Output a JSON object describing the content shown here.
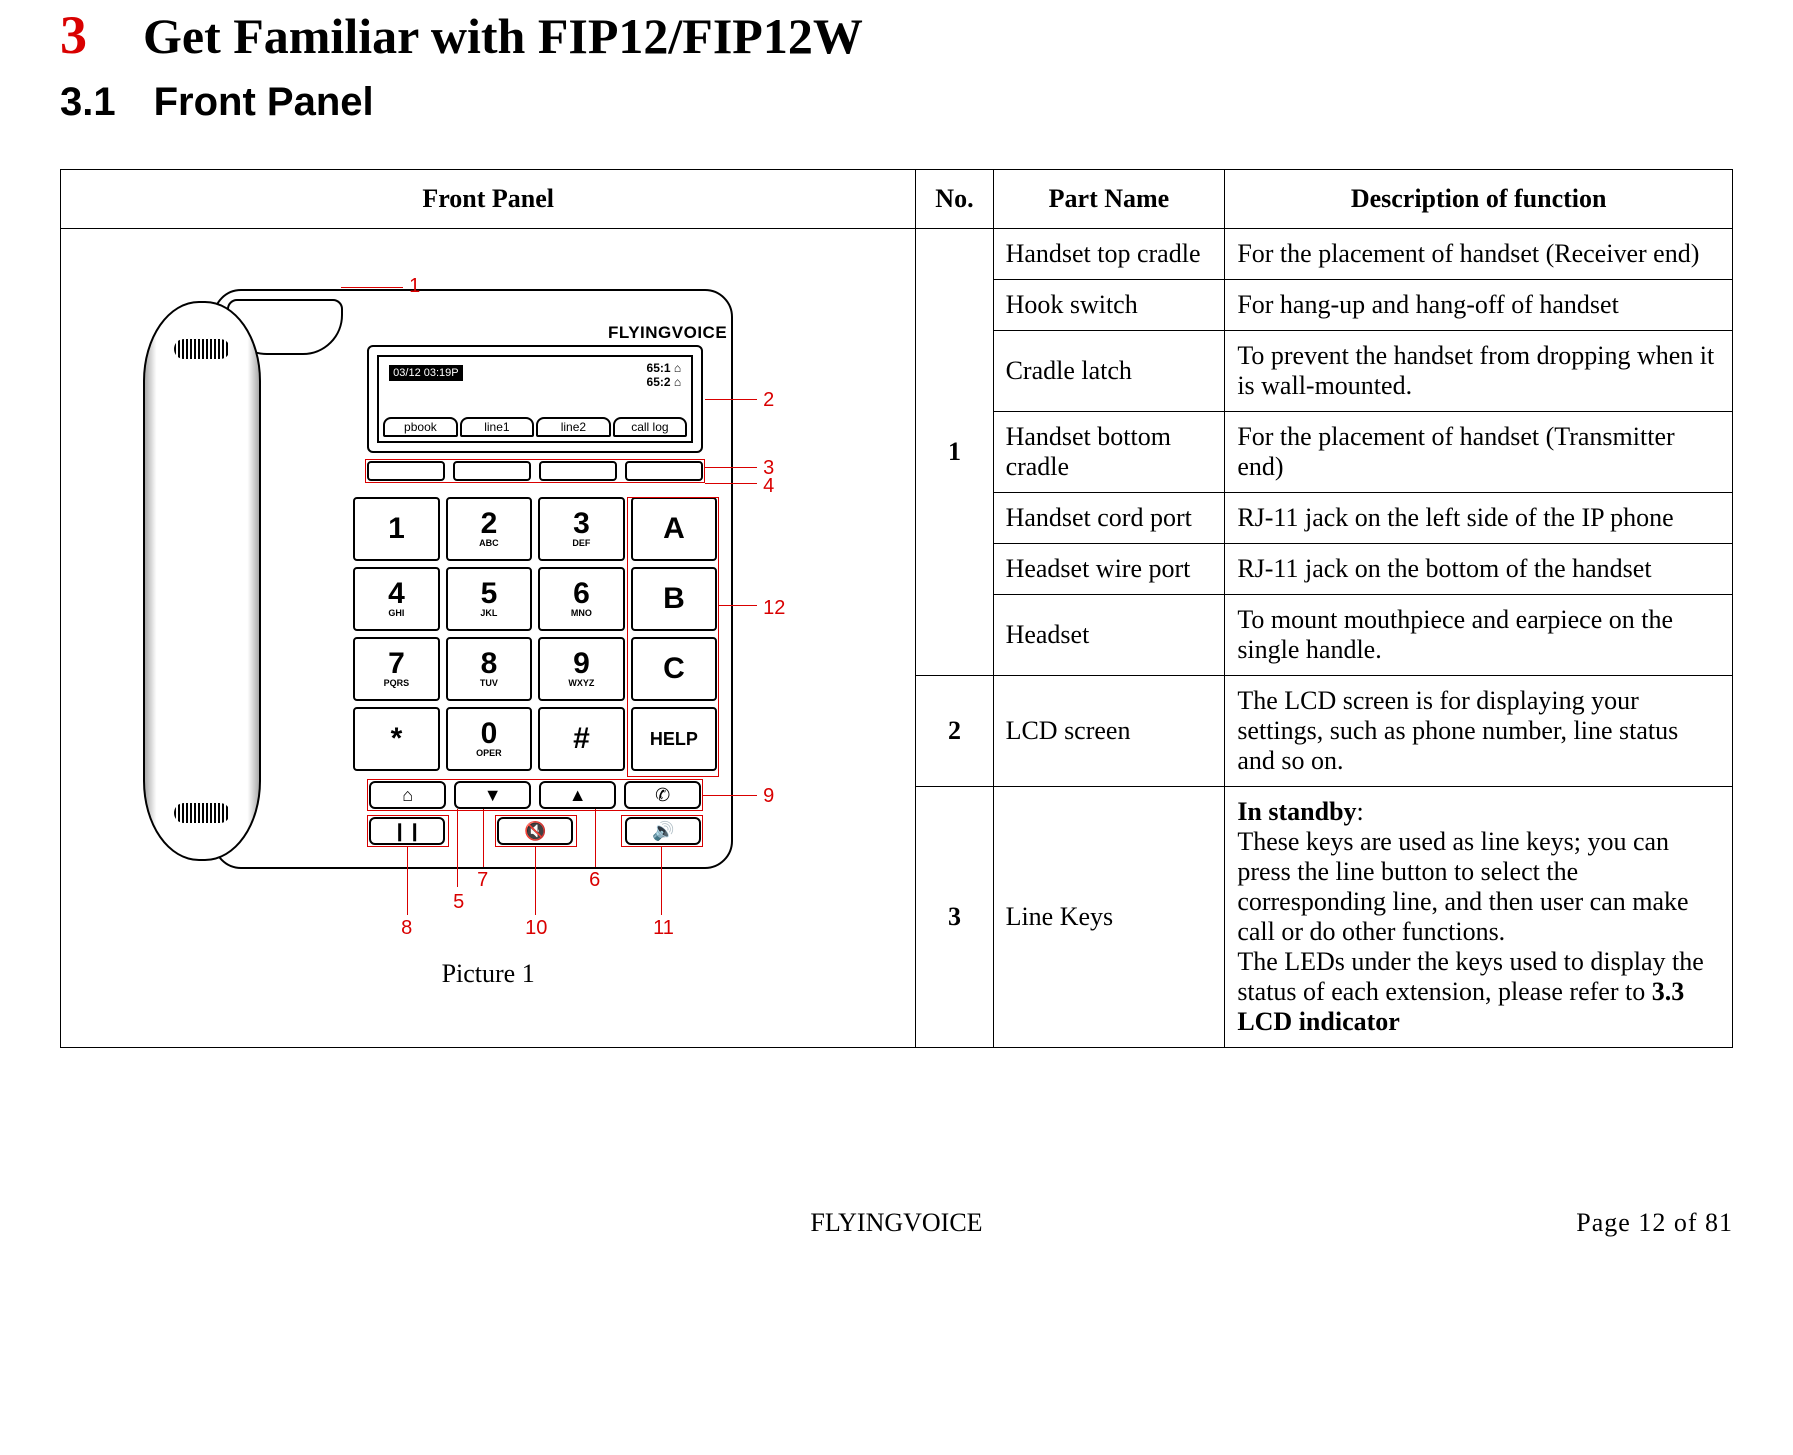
{
  "chapter": {
    "num": "3",
    "title": "Get Familiar with FIP12/FIP12W"
  },
  "section": {
    "num": "3.1",
    "title": "Front Panel"
  },
  "table": {
    "headers": {
      "c1": "Front Panel",
      "c2": "No.",
      "c3": "Part Name",
      "c4": "Description of function"
    },
    "caption": "Picture 1",
    "rows": [
      {
        "no": "1",
        "part": "Handset top cradle",
        "func": "For the placement of handset (Receiver end)"
      },
      {
        "no": "1",
        "part": "Hook switch",
        "func": "For hang-up and hang-off of handset"
      },
      {
        "no": "1",
        "part": "Cradle latch",
        "func": "To prevent the handset from dropping when it is wall-mounted."
      },
      {
        "no": "1",
        "part": "Handset bottom cradle",
        "func": "For the placement of handset (Transmitter end)"
      },
      {
        "no": "1",
        "part": "Handset cord port",
        "func": "RJ-11 jack on the left side of the IP phone"
      },
      {
        "no": "1",
        "part": "Headset wire port",
        "func": "RJ-11 jack on the bottom of the handset"
      },
      {
        "no": "1",
        "part": "Headset",
        "func": "To mount mouthpiece and earpiece on the single handle."
      },
      {
        "no": "2",
        "part": "LCD screen",
        "func": "The LCD screen is for displaying your settings, such as phone number, line status and so on."
      },
      {
        "no": "3",
        "part": "Line Keys",
        "func_prefix_bold": "In standby",
        "func_rest": ":\nThese keys are used as line keys; you can press the line button to select the corresponding line, and then user can make call or do other functions.\nThe LEDs under the keys used to display the status of each extension, please refer to ",
        "func_suffix_bold": "3.3 LCD indicator"
      }
    ]
  },
  "phone": {
    "brand": "FLYINGVOICE",
    "lcd": {
      "datetime": "03/12  03:19P",
      "ext1": "65:1 ⌂",
      "ext2": "65:2 ⌂",
      "soft": [
        "pbook",
        "line1",
        "line2",
        "call log"
      ]
    },
    "keypad": [
      [
        "1",
        ""
      ],
      [
        "2",
        "ABC"
      ],
      [
        "3",
        "DEF"
      ],
      [
        "A",
        ""
      ],
      [
        "4",
        "GHI"
      ],
      [
        "5",
        "JKL"
      ],
      [
        "6",
        "MNO"
      ],
      [
        "B",
        ""
      ],
      [
        "7",
        "PQRS"
      ],
      [
        "8",
        "TUV"
      ],
      [
        "9",
        "WXYZ"
      ],
      [
        "C",
        ""
      ],
      [
        "*",
        ""
      ],
      [
        "0",
        "OPER"
      ],
      [
        "#",
        ""
      ],
      [
        "HELP",
        ""
      ]
    ],
    "nav1": [
      "⌂",
      "▼",
      "▲",
      "✆"
    ],
    "nav2": [
      "❙❙",
      "🔇",
      "🔊"
    ],
    "callouts": [
      "1",
      "2",
      "3",
      "4",
      "5",
      "6",
      "7",
      "8",
      "9",
      "10",
      "11",
      "12"
    ]
  },
  "footer": {
    "center": "FLYINGVOICE",
    "right": "Page  12  of  81"
  }
}
